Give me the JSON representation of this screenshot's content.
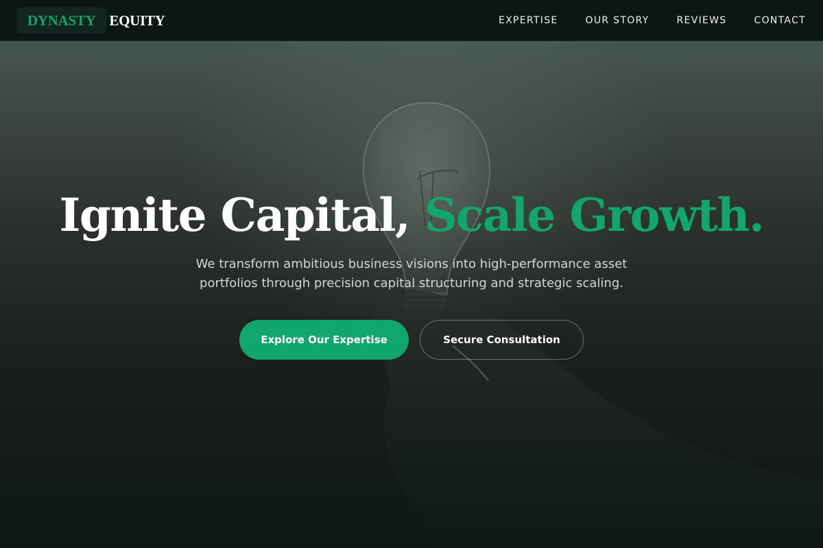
{
  "brand": {
    "mark": "DYNASTY",
    "name": "EQUITY",
    "accent_color": "#10a66e"
  },
  "nav": {
    "items": [
      {
        "label": "EXPERTISE"
      },
      {
        "label": "OUR STORY"
      },
      {
        "label": "REVIEWS"
      },
      {
        "label": "CONTACT"
      }
    ]
  },
  "hero": {
    "background_image": "lightbulb-in-hand-photo",
    "headline_white": "Ignite Capital,",
    "headline_green": "Scale Growth.",
    "subtext": "We transform ambitious business visions into high-performance asset portfolios through precision capital structuring and strategic scaling.",
    "primary_button": "Explore Our Expertise",
    "secondary_button": "Secure Consultation"
  }
}
